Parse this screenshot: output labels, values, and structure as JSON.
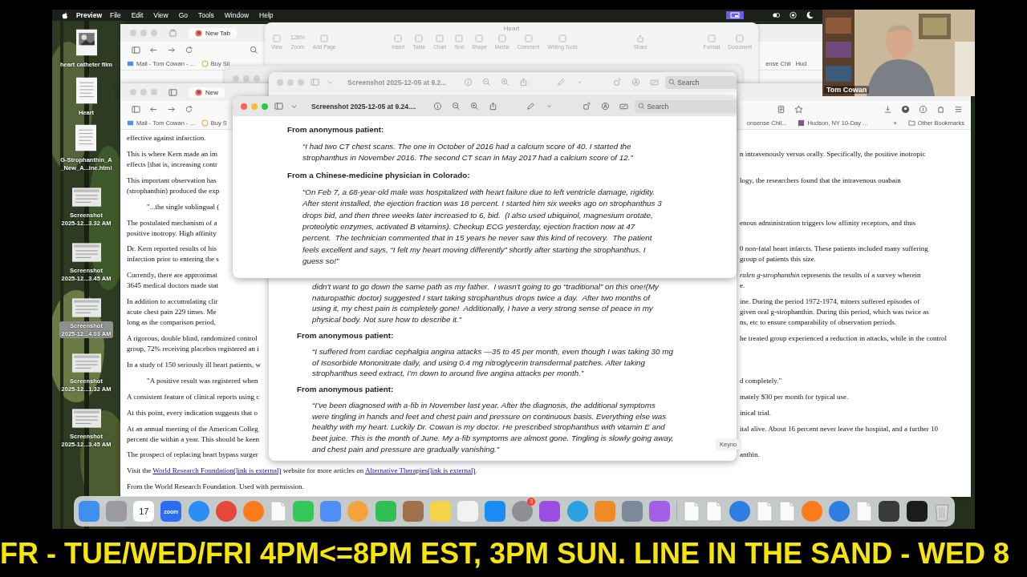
{
  "menu_bar": {
    "app": "Preview",
    "items": [
      "File",
      "Edit",
      "View",
      "Go",
      "Tools",
      "Window",
      "Help"
    ]
  },
  "desktop_icons": [
    {
      "label": "heart catheter film",
      "selected": false
    },
    {
      "kind": "doc",
      "label": "Heart",
      "selected": false
    },
    {
      "kind": "doc",
      "label": "G-Strophanthin_A\n_New_A...ine.html",
      "selected": false
    },
    {
      "kind": "shot",
      "label": "Screenshot\n2025-12...3.32 AM",
      "selected": false
    },
    {
      "kind": "shot",
      "label": "Screenshot\n2025-12...3.45 AM",
      "selected": false
    },
    {
      "kind": "shot",
      "label": "Screenshot\n2025-12...4.03 AM",
      "selected": true
    },
    {
      "kind": "shot",
      "label": "Screenshot\n2025-12...1.32 AM",
      "selected": false
    },
    {
      "kind": "shot",
      "label": "Screenshot\n2025-12...3.45 AM",
      "selected": false
    }
  ],
  "webcam": {
    "name": "Tom Cowan"
  },
  "browser_back": {
    "tab": "New Tab",
    "bookmarks": [
      "Mail - Tom Cowan - ...",
      "Buy Sil"
    ],
    "bookmarks_right": [
      "ense Chil",
      "Hud"
    ]
  },
  "pages_window": {
    "title": "Heart",
    "zoom": "128%",
    "tools_left": [
      "View",
      "Zoom",
      "Add Page"
    ],
    "tools_center": [
      "Insert",
      "Table",
      "Chart",
      "Text",
      "Shape",
      "Media",
      "Comment",
      "Writing Tools"
    ],
    "tools_share": [
      "Share"
    ],
    "tools_right": [
      "Format",
      "Document"
    ]
  },
  "browser": {
    "tab": "New",
    "bookmarks": [
      "Mail - Tom Cowan - ...",
      "Buy S"
    ],
    "bookmarks_right": [
      "onsense Chil...",
      "Hudson, NY 10-Day ..."
    ],
    "overflow": "»",
    "other_bookmarks": "Other Bookmarks",
    "article": [
      {
        "kind": "para",
        "left": [
          "effective against infarction."
        ]
      },
      {
        "kind": "para",
        "left": [
          "This is where Kern made an im",
          "effects [that is, increasing contr"
        ],
        "right": [
          "n intravenously versus orally. Specifically, the positive inotropic"
        ]
      },
      {
        "kind": "para",
        "left": [
          "This important observation has",
          "(strophanthin) produced the exp"
        ],
        "right": [
          "logy, the researchers found that the intravenous ouabain"
        ]
      },
      {
        "kind": "quote",
        "left": [
          "\"...the single sublingual ("
        ]
      },
      {
        "kind": "para",
        "left": [
          "The postulated mechanism of a",
          "positive inotropy. High affinity"
        ],
        "right": [
          "enous administration triggers low affinity receptors, and thus"
        ]
      },
      {
        "kind": "para",
        "left": [
          "Dr. Kern reported results of his",
          "infarction prior to entering the s"
        ],
        "right": [
          "0 non-fatal heart infarcts. These patients included many suffering",
          "group of patients this size."
        ]
      },
      {
        "kind": "para",
        "left": [
          "Currently, there are approximat",
          "3645 medical doctors made stat"
        ],
        "right": [
          "*ralen g-strophanthin* represents the results of a survey wherein",
          "e."
        ]
      },
      {
        "kind": "para",
        "left": [
          "In addition to accumulating clir",
          "acute chest pain 229 times. Me",
          "long as the comparison period,"
        ],
        "right": [
          "ine. During the period 1972-1974, miners suffered episodes of",
          "given oral g-strophanthin. During this period, which was twice as",
          "ns, etc to ensure comparability of observation periods."
        ]
      },
      {
        "kind": "para",
        "left": [
          "A rigorous, double blind, randomized control",
          "group, 72% receiving placebos registered an i"
        ],
        "right": [
          "he treated group experienced a reduction in attacks, while in the control"
        ]
      },
      {
        "kind": "para",
        "left": [
          "In a study of 150 seriously ill heart patients, w"
        ]
      },
      {
        "kind": "quote",
        "left": [
          "\"A positive result was registered when"
        ],
        "right": [
          "d completely.\""
        ]
      },
      {
        "kind": "para",
        "left": [
          "A consistent feature of clinical reports using c"
        ],
        "right": [
          "mately $30 per month for typical use."
        ]
      },
      {
        "kind": "para",
        "left": [
          "At this point, every indication suggests that o"
        ],
        "right": [
          "inical trial."
        ]
      },
      {
        "kind": "para",
        "left": [
          "At an annual meeting of the American Colleg",
          "percent die within a year. This should be keen"
        ],
        "right": [
          "ital alive. About 16 percent never leave the hospital, and a further 10"
        ]
      },
      {
        "kind": "para",
        "left": [
          "The prospect of replacing heart bypass surger"
        ],
        "right": [
          "anthin."
        ]
      },
      {
        "kind": "links",
        "parts": [
          {
            "kind": "text",
            "text": "Visit the "
          },
          {
            "kind": "link",
            "text": "World Research Foundation(link is external)"
          },
          {
            "kind": "text",
            "text": " website for more articles on "
          },
          {
            "kind": "link",
            "text": "Alternative Therapies(link is external)"
          },
          {
            "kind": "text",
            "text": "."
          }
        ]
      },
      {
        "kind": "para",
        "left": [
          "From the World Research Foundation. Used with permission."
        ]
      }
    ]
  },
  "preview_windows": [
    {
      "title": "Screenshot 2025-12-05 at 9.2...",
      "active": false,
      "search_placeholder": "Search",
      "blocks": [
        {
          "kind": "quote",
          "lines": [
            "didn't want to go down the same path as my father.  I wasn't going to go “traditional” on this one!(My",
            "naturopathic doctor) suggested I start taking strophanthus drops twice a day.  After two months of",
            "using it, my chest pain is completely gone!  Additionally, I have a very strong sense of peace in my",
            "physical body. Not sure how to describe it.”"
          ]
        },
        {
          "kind": "heading",
          "lines": [
            "From anonymous patient:"
          ]
        },
        {
          "kind": "quote",
          "lines": [
            "“I suffered from cardiac cephalgia angina attacks —35 to 45 per month, even though I was taking 30 mg",
            "of Isosorbide Mononitrate daily, and using 0.4 mg nitroglycerin transdermal patches. After taking",
            "strophanthus seed extract, I’m down to around five angina attacks per month.”"
          ]
        },
        {
          "kind": "heading",
          "lines": [
            "From anonymous patient:"
          ]
        },
        {
          "kind": "quote",
          "lines": [
            "“I’ve been diagnosed with a-fib in November last year. After the diagnosis, the additional symptoms",
            "were tingling in hands and feet and chest pain and pressure on continuous basis. Everything else was",
            "healthy with my heart. Luckily Dr. Cowan is my doctor. He prescribed strophanthus with vitamin E and",
            "beet juice. This is the month of June. My a-fib symptoms are almost gone. Tingling is slowly going away,",
            "and chest pain and pressure are gradually vanishing.”"
          ]
        }
      ]
    },
    {
      "title": "Screenshot 2025-12-05 at 9.24....",
      "active": true,
      "search_placeholder": "Search",
      "blocks": [
        {
          "kind": "heading",
          "lines": [
            "From anonymous patient:"
          ]
        },
        {
          "kind": "quote",
          "lines": [
            "“I had two CT chest scans. The one in October of 2016 had a calcium score of 40. I started the",
            "strophanthus in November 2016. The second CT scan in May 2017 had a calcium score of 12.”"
          ]
        },
        {
          "kind": "heading",
          "lines": [
            "From a Chinese-medicine physician in Colorado:"
          ]
        },
        {
          "kind": "quote",
          "lines": [
            "“On Feb 7, a 68-year-old male was hospitalized with heart failure due to left ventricle damage, rigidity.",
            "After stent installed, the ejection fraction was 18 percent. I started him six weeks ago on strophanthus 3",
            "drops bid, and then three weeks later increased to 6, bid.  (I also used ubiquinol, magnesium orotate,",
            "proteolytic enzymes, activated B vitamins). Checkup ECG yesterday, ejection fraction now at 47",
            "percent.  The technician commented that in 15 years he never saw this kind of recovery.  The patient",
            "feels excellent and says, “I felt my heart moving differently” shortly after starting the strophanthus. I",
            "guess so!”"
          ]
        }
      ]
    }
  ],
  "tooltip": "Keyno",
  "dock": [
    {
      "kind": "tile",
      "color": "#3d8ff0"
    },
    {
      "kind": "tile",
      "color": "#9a9aa0"
    },
    {
      "kind": "calendar",
      "text": "17"
    },
    {
      "kind": "label",
      "text": "zoom",
      "color": "#2d6cf5"
    },
    {
      "kind": "round",
      "color": "#2a8ef5"
    },
    {
      "kind": "round",
      "color": "#e5483b"
    },
    {
      "kind": "round",
      "color": "#ff7b1a"
    },
    {
      "kind": "doc"
    },
    {
      "kind": "tile",
      "color": "#34c759"
    },
    {
      "kind": "tile",
      "color": "#4f8ff7"
    },
    {
      "kind": "round",
      "color": "#f4a23c"
    },
    {
      "kind": "tile",
      "color": "#2fbf55"
    },
    {
      "kind": "tile",
      "color": "#a0704a"
    },
    {
      "kind": "tile",
      "color": "#f7d24b"
    },
    {
      "kind": "tile",
      "color": "#f2f2f2"
    },
    {
      "kind": "tile",
      "color": "#1b8cf4"
    },
    {
      "kind": "round",
      "color": "#8e8e93",
      "badge": "3"
    },
    {
      "kind": "tile",
      "color": "#9b4de0"
    },
    {
      "kind": "round",
      "color": "#2aa1e0"
    },
    {
      "kind": "tile",
      "color": "#f08a24"
    },
    {
      "kind": "tile",
      "color": "#7d8a99"
    },
    {
      "kind": "tile",
      "color": "#a45de6"
    },
    {
      "kind": "divider"
    },
    {
      "kind": "doc"
    },
    {
      "kind": "doc"
    },
    {
      "kind": "round",
      "color": "#2e7de0"
    },
    {
      "kind": "doc"
    },
    {
      "kind": "doc"
    },
    {
      "kind": "round",
      "color": "#ff7b1a"
    },
    {
      "kind": "round",
      "color": "#2e7de0"
    },
    {
      "kind": "doc"
    },
    {
      "kind": "tile",
      "color": "#3a3a3a"
    },
    {
      "kind": "tile",
      "color": "#1c1c1c"
    },
    {
      "kind": "trash"
    }
  ],
  "ticker": "FR - TUE/WED/FRI 4PM<=8PM EST, 3PM SUN. LINE IN THE SAND - WED 8"
}
